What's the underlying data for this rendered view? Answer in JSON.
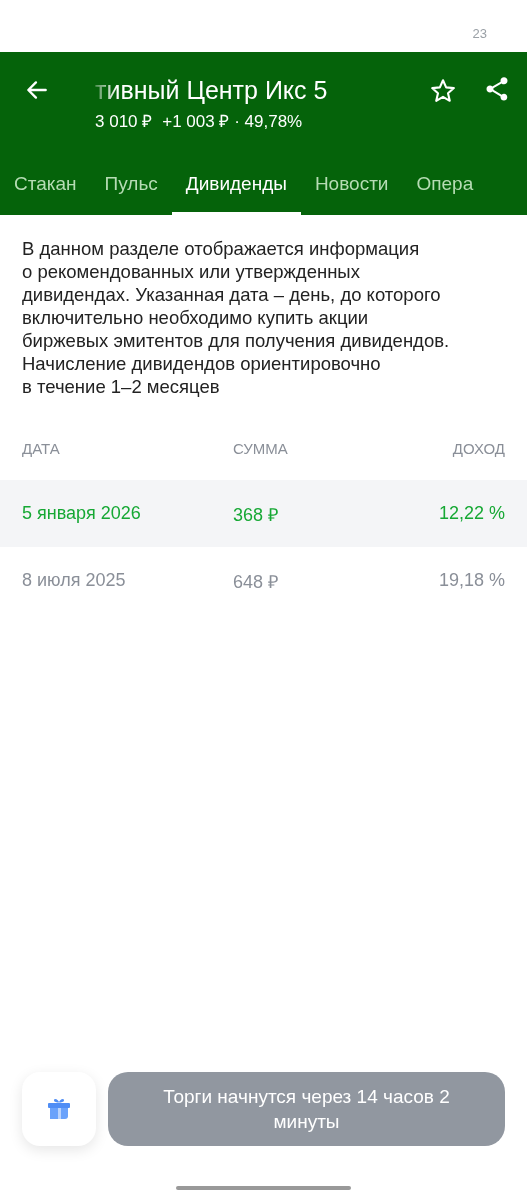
{
  "status_bar": {
    "time": "23"
  },
  "header": {
    "title": "тивный Центр Икс 5",
    "price": "3 010 ₽",
    "change": "+1 003 ₽ · 49,78%",
    "favorite": false
  },
  "tabs": [
    {
      "label": "Стакан",
      "selected": false
    },
    {
      "label": "Пульс",
      "selected": false
    },
    {
      "label": "Дивиденды",
      "selected": true
    },
    {
      "label": "Новости",
      "selected": false
    },
    {
      "label": "Опера",
      "selected": false
    }
  ],
  "info": "В данном разделе отображается информация\nо рекомендованных или утвержденных\nдивидендах. Указанная дата – день, до которого\nвключительно необходимо купить акции\nбиржевых эмитентов для получения дивидендов.\nНачисление дивидендов ориентировочно\nв течение 1–2 месяцев",
  "table": {
    "columns": [
      "ДАТА",
      "СУММА",
      "ДОХОД"
    ],
    "rows": [
      {
        "date": "5 января 2026",
        "amount": "368 ₽",
        "yield": "12,22 %",
        "selected": true
      },
      {
        "date": "8 июля 2025",
        "amount": "648 ₽",
        "yield": "19,18 %",
        "selected": false
      }
    ]
  },
  "toast": {
    "text": "Торги начнутся через 14 часов 2 минуты"
  }
}
